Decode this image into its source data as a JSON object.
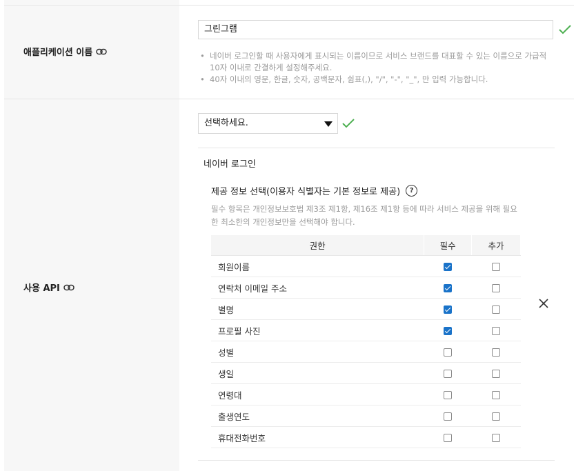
{
  "app_name_row": {
    "label": "애플리케이션 이름",
    "value": "그린그램",
    "help": [
      "네이버 로그인할 때 사용자에게 표시되는 이름이므로 서비스 브랜드를 대표할 수 있는 이름으로 가급적 10자 이내로 간결하게 설정해주세요.",
      "40자 이내의 영문, 한글, 숫자, 공백문자, 쉼표(,), \"/\", \"-\", \"_\", 만 입력 가능합니다."
    ]
  },
  "api_row": {
    "label": "사용 API",
    "select_value": "선택하세요.",
    "section_title": "네이버 로그인",
    "provide_title": "제공 정보 선택(이용자 식별자는 기본 정보로 제공)",
    "provide_desc": "필수 항목은 개인정보보호법 제3조 제1항, 제16조 제1항 등에 따라 서비스 제공을 위해 필요한 최소한의 개인정보만을 선택해야 합니다.",
    "table_headers": {
      "permission": "권한",
      "required": "필수",
      "additional": "추가"
    },
    "permissions": [
      {
        "name": "회원이름",
        "required": true,
        "additional": false
      },
      {
        "name": "연락처 이메일 주소",
        "required": true,
        "additional": false
      },
      {
        "name": "별명",
        "required": true,
        "additional": false
      },
      {
        "name": "프로필 사진",
        "required": true,
        "additional": false
      },
      {
        "name": "성별",
        "required": false,
        "additional": false
      },
      {
        "name": "생일",
        "required": false,
        "additional": false
      },
      {
        "name": "연령대",
        "required": false,
        "additional": false
      },
      {
        "name": "출생연도",
        "required": false,
        "additional": false
      },
      {
        "name": "휴대전화번호",
        "required": false,
        "additional": false
      }
    ]
  },
  "colors": {
    "check_green": "#4caf50",
    "checkbox_blue": "#1a73c9",
    "label_bg": "#f7f7f7"
  },
  "icons": [
    "link-icon",
    "check-icon",
    "chevron-down-icon",
    "help-icon",
    "close-icon"
  ]
}
